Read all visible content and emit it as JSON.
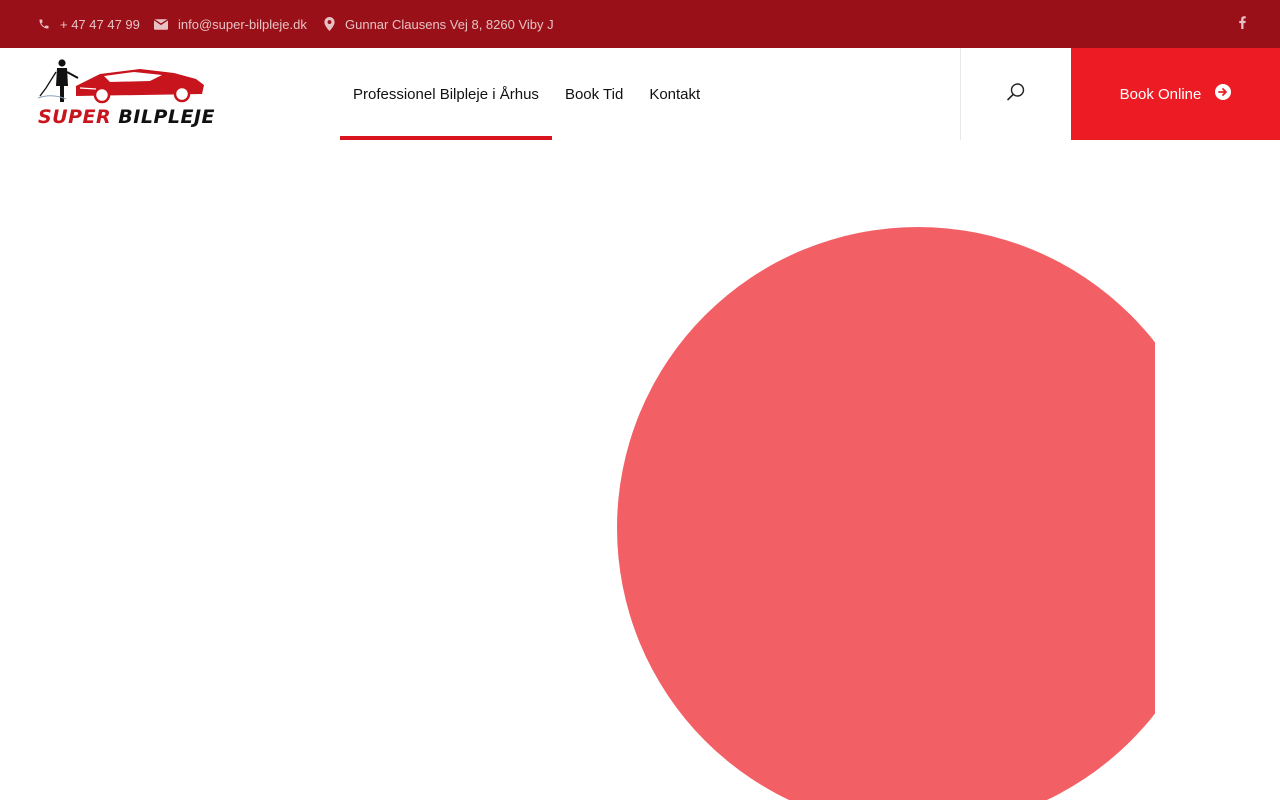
{
  "topbar": {
    "phone": "+ 47 47 47 99",
    "email": "info@super-bilpleje.dk",
    "address": "Gunnar Clausens Vej 8, 8260 Viby J",
    "icons": {
      "phone": "phone-icon",
      "email": "envelope-icon",
      "address": "map-pin-icon",
      "social": "facebook-icon"
    }
  },
  "logo": {
    "word1": "SUPER",
    "word2": "BILPLEJE"
  },
  "nav": {
    "items": [
      {
        "label": "Professionel Bilpleje i Århus",
        "active": true
      },
      {
        "label": "Book Tid",
        "active": false
      },
      {
        "label": "Kontakt",
        "active": false
      }
    ]
  },
  "header": {
    "search_icon": "search-icon",
    "book_label": "Book Online",
    "book_icon": "arrow-circle-right-icon"
  },
  "colors": {
    "topbar_bg": "#9a1018",
    "accent": "#ed1c24",
    "active_underline": "#d9141e",
    "hero_circle": "#f26066"
  }
}
